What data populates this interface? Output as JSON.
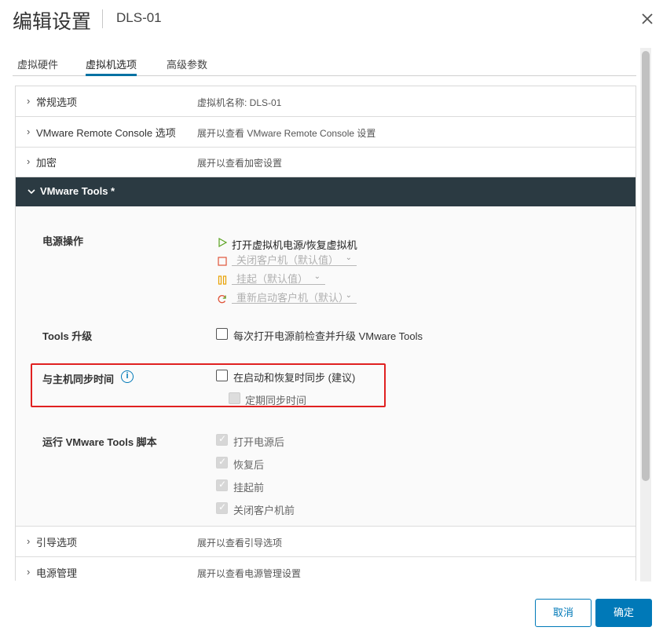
{
  "dialog": {
    "title": "编辑设置",
    "vm_name": "DLS-01"
  },
  "tabs": [
    {
      "label": "虚拟硬件"
    },
    {
      "label": "虚拟机选项",
      "active": true
    },
    {
      "label": "高级参数"
    }
  ],
  "rows": {
    "general": {
      "name": "常规选项",
      "desc": "虚拟机名称: DLS-01"
    },
    "vmrc": {
      "name": "VMware Remote Console 选项",
      "desc": "展开以查看 VMware Remote Console 设置"
    },
    "encryption": {
      "name": "加密",
      "desc": "展开以查看加密设置"
    },
    "tools": {
      "name": "VMware Tools *"
    },
    "boot": {
      "name": "引导选项",
      "desc": "展开以查看引导选项"
    },
    "power_mgmt": {
      "name": "电源管理",
      "desc": "展开以查看电源管理设置"
    }
  },
  "tools_section": {
    "power_ops": {
      "label": "电源操作",
      "power_on": "打开虚拟机电源/恢复虚拟机",
      "shutdown": "关闭客户机（默认值）",
      "suspend": "挂起（默认值）",
      "restart": "重新启动客户机（默认）"
    },
    "upgrade": {
      "label": "Tools 升级",
      "checkbox": "每次打开电源前检查并升级 VMware Tools",
      "checked": false
    },
    "time_sync": {
      "label": "与主机同步时间",
      "startup_sync": "在启动和恢复时同步 (建议)",
      "startup_sync_checked": false,
      "periodic_sync": "定期同步时间"
    },
    "scripts": {
      "label": "运行 VMware Tools 脚本",
      "items": [
        "打开电源后",
        "恢复后",
        "挂起前",
        "关闭客户机前"
      ]
    }
  },
  "colors": {
    "accent": "#0079b8",
    "header_dark": "#2b3a42",
    "highlight": "#e02020",
    "play": "#5aa220",
    "stop": "#e0553a",
    "pause": "#e8a100"
  },
  "footer": {
    "cancel": "取消",
    "ok": "确定"
  }
}
